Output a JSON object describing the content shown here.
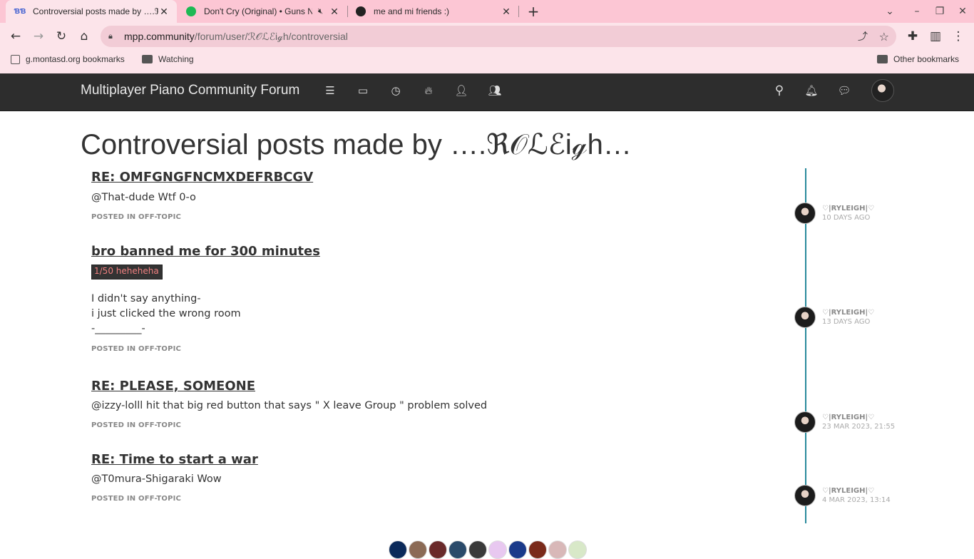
{
  "browser": {
    "tabs": [
      {
        "title": "Controversial posts made by ….ℜ",
        "favicon": "nodebb-icon",
        "active": true
      },
      {
        "title": "Don't Cry (Original) • Guns N",
        "favicon": "spotify-icon",
        "active": false
      },
      {
        "title": "me and mi friends :)",
        "favicon": "avatar-icon",
        "active": false
      }
    ],
    "url_domain": "mpp.community",
    "url_path": "/forum/user/ℛ𝒪ℒℰiℊh/controversial",
    "bookmarks": [
      {
        "label": "g.montasd.org bookmarks"
      },
      {
        "label": "Watching"
      }
    ],
    "other_bookmarks": "Other bookmarks",
    "accent": "#fcc6d4"
  },
  "forum": {
    "brand": "Multiplayer Piano Community Forum",
    "nav_icons": [
      "categories-icon",
      "unread-icon",
      "recent-icon",
      "popular-icon",
      "users-icon",
      "groups-icon"
    ],
    "right_icons": [
      "search-icon",
      "notifications-icon",
      "chat-icon"
    ],
    "header_bg": "#2d2d2d"
  },
  "page": {
    "title": "Controversial posts made by ….ℜ𝒪ℒℰiℊh…"
  },
  "posts": [
    {
      "title": "RE: OMFGNGFNCMXDEFRBCGV",
      "body": [
        "@That-dude Wtf 0-o"
      ],
      "meta": "POSTED IN OFF-TOPIC",
      "user": "♡|RYLEIGH|♡",
      "time": "10 DAYS AGO"
    },
    {
      "title": "bro banned me for 300 minutes",
      "badge": "1/50 heheheha",
      "body": [
        "I didn't say anything-",
        "i just clicked the wrong room",
        "-_________-"
      ],
      "meta": "POSTED IN OFF-TOPIC",
      "user": "♡|RYLEIGH|♡",
      "time": "13 DAYS AGO"
    },
    {
      "title": "RE: PLEASE, SOMEONE",
      "body": [
        "@izzy-lolll hit that big red button that says \" X leave Group \" problem solved"
      ],
      "meta": "POSTED IN OFF-TOPIC",
      "user": "♡|RYLEIGH|♡",
      "time": "23 MAR 2023, 21:55"
    },
    {
      "title": "RE: Time to start a war",
      "body": [
        "@T0mura-Shigaraki Wow"
      ],
      "meta": "POSTED IN OFF-TOPIC",
      "user": "♡|RYLEIGH|♡",
      "time": "4 MAR 2023, 13:14"
    }
  ],
  "timeline_color": "#2a8a9c"
}
